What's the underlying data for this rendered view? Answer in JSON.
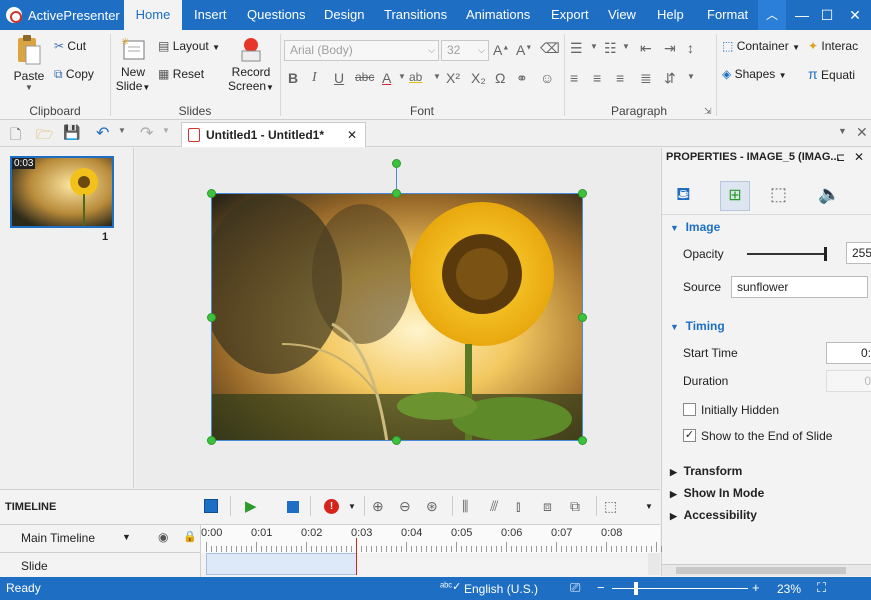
{
  "app": {
    "name": "ActivePresenter"
  },
  "ribbon_tabs": [
    "Home",
    "Insert",
    "Questions",
    "Design",
    "Transitions",
    "Animations",
    "Export",
    "View",
    "Help",
    "Format"
  ],
  "active_tab": "Home",
  "window_controls": {
    "collapse": "≈",
    "minimize": "—",
    "maximize": "☐",
    "close": "✕"
  },
  "ribbon": {
    "clipboard": {
      "label": "Clipboard",
      "paste": "Paste",
      "cut": "Cut",
      "copy": "Copy"
    },
    "slides": {
      "label": "Slides",
      "new_slide_1": "New",
      "new_slide_2": "Slide",
      "layout": "Layout",
      "reset": "Reset",
      "record_1": "Record",
      "record_2": "Screen"
    },
    "font": {
      "label": "Font",
      "family": "Arial (Body)",
      "size": "32"
    },
    "paragraph": {
      "label": "Paragraph"
    },
    "insert": {
      "container": "Container",
      "interaction": "Interac",
      "shapes": "Shapes",
      "equation": "Equati"
    }
  },
  "document": {
    "tab_title": "Untitled1 - Untitled1*"
  },
  "slide_list": [
    {
      "time": "0:03",
      "number": "1"
    }
  ],
  "properties": {
    "title": "PROPERTIES - IMAGE_5 (IMAG...",
    "image_section": "Image",
    "opacity_label": "Opacity",
    "opacity_value": "255",
    "source_label": "Source",
    "source_value": "sunflower",
    "timing_section": "Timing",
    "start_time_label": "Start Time",
    "start_time_value": "0:",
    "duration_label": "Duration",
    "duration_value": "0",
    "initially_hidden": "Initially Hidden",
    "show_to_end": "Show to the End of Slide",
    "transform": "Transform",
    "show_in_mode": "Show In Mode",
    "accessibility": "Accessibility"
  },
  "timeline": {
    "title": "TIMELINE",
    "track_main": "Main Timeline",
    "track_slide": "Slide",
    "ticks": [
      "0:00",
      "0:01",
      "0:02",
      "0:03",
      "0:04",
      "0:05",
      "0:06",
      "0:07",
      "0:08"
    ]
  },
  "status": {
    "ready": "Ready",
    "language": "English (U.S.)",
    "zoom": "23%"
  },
  "colors": {
    "accent": "#1e6fc4",
    "handle": "#3ec23e"
  }
}
